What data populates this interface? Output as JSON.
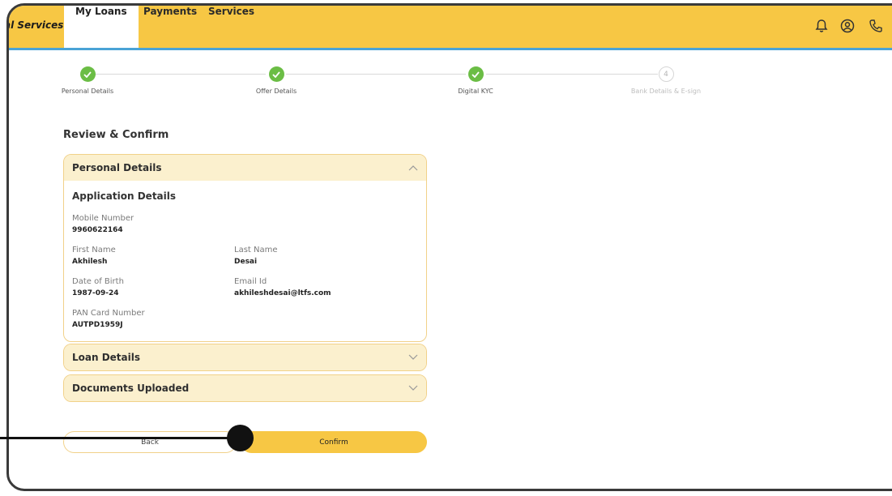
{
  "topbar": {
    "brand": "al Services",
    "nav": [
      {
        "label": "My Loans"
      },
      {
        "label": "Payments"
      },
      {
        "label": "Services"
      }
    ]
  },
  "stepper": {
    "steps": [
      {
        "label": "Personal Details",
        "status": "done"
      },
      {
        "label": "Offer Details",
        "status": "done"
      },
      {
        "label": "Digital KYC",
        "status": "done"
      },
      {
        "label": "Bank Details & E-sign",
        "status": "pending",
        "number": "4"
      }
    ]
  },
  "review": {
    "title": "Review & Confirm",
    "personal": {
      "header": "Personal Details",
      "subtitle": "Application Details",
      "mobile_label": "Mobile Number",
      "mobile_value": "9960622164",
      "first_name_label": "First Name",
      "first_name_value": "Akhilesh",
      "last_name_label": "Last Name",
      "last_name_value": "Desai",
      "dob_label": "Date of Birth",
      "dob_value": "1987-09-24",
      "email_label": "Email Id",
      "email_value": "akhileshdesai@ltfs.com",
      "pan_label": "PAN Card Number",
      "pan_value": "AUTPD1959J"
    },
    "loan_header": "Loan Details",
    "documents_header": "Documents Uploaded"
  },
  "actions": {
    "back_label": "Back",
    "confirm_label": "Confirm"
  },
  "colors": {
    "accent": "#f7c744",
    "success": "#6bbd45",
    "panel_bg": "#fbf0ce",
    "panel_border": "#f1d189",
    "topbar_underline": "#4aa3d6"
  }
}
